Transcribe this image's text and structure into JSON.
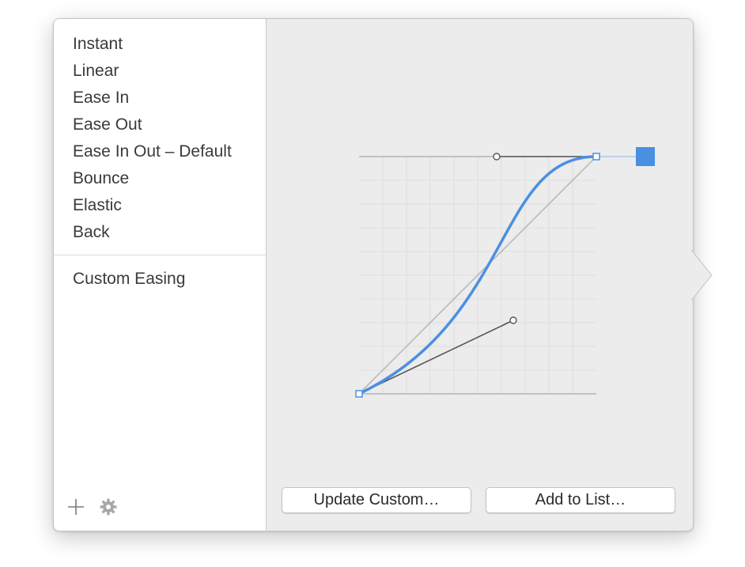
{
  "presets": [
    {
      "label": "Instant"
    },
    {
      "label": "Linear"
    },
    {
      "label": "Ease In"
    },
    {
      "label": "Ease Out"
    },
    {
      "label": "Ease In Out – Default"
    },
    {
      "label": "Bounce"
    },
    {
      "label": "Elastic"
    },
    {
      "label": "Back"
    }
  ],
  "custom_section": {
    "items": [
      {
        "label": "Custom Easing"
      }
    ]
  },
  "toolbar": {
    "add_icon": "plus-icon",
    "settings_icon": "gear-icon"
  },
  "buttons": {
    "update_custom": "Update Custom…",
    "add_to_list": "Add to List…"
  },
  "curve": {
    "control_point_1": [
      0.65,
      0.31
    ],
    "control_point_2": [
      0.58,
      1.0
    ],
    "grid_divisions": 10,
    "curve_color": "#4a90e2",
    "handle_color": "#555555",
    "linear_reference_color": "#b4b4b4"
  },
  "colors": {
    "accent": "#4a90e2",
    "panel_bg": "#ececec",
    "sidebar_bg": "#ffffff"
  }
}
